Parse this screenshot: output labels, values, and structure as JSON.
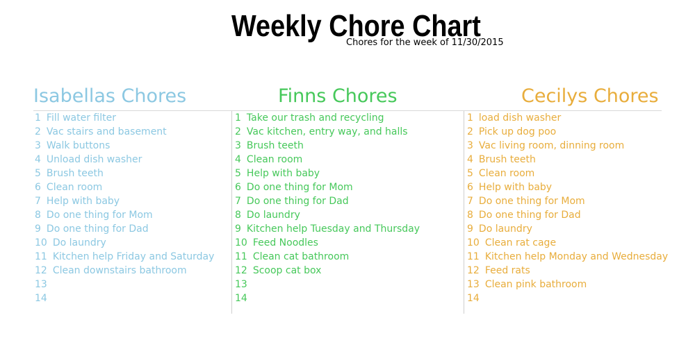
{
  "title": "Weekly Chore Chart",
  "subtitle": "Chores for the week of 11/30/2015",
  "colors": {
    "isabella": "#8cc8e2",
    "finn": "#46c85a",
    "cecily": "#e8ad3c"
  },
  "columns": [
    {
      "heading": "Isabellas Chores",
      "items": [
        {
          "num": "1",
          "text": "Fill water filter"
        },
        {
          "num": "2",
          "text": "Vac stairs and basement"
        },
        {
          "num": "3",
          "text": "Walk buttons"
        },
        {
          "num": "4",
          "text": "Unload dish washer"
        },
        {
          "num": "5",
          "text": "Brush teeth"
        },
        {
          "num": "6",
          "text": "Clean room"
        },
        {
          "num": "7",
          "text": "Help with baby"
        },
        {
          "num": "8",
          "text": "Do one thing for Mom"
        },
        {
          "num": "9",
          "text": "Do one thing for Dad"
        },
        {
          "num": "10",
          "text": "Do laundry"
        },
        {
          "num": "11",
          "text": "Kitchen help Friday and Saturday"
        },
        {
          "num": "12",
          "text": "Clean downstairs bathroom"
        },
        {
          "num": "13",
          "text": ""
        },
        {
          "num": "14",
          "text": ""
        }
      ]
    },
    {
      "heading": "Finns Chores",
      "items": [
        {
          "num": "1",
          "text": "Take our trash and recycling"
        },
        {
          "num": "2",
          "text": "Vac kitchen, entry way, and halls"
        },
        {
          "num": "3",
          "text": "Brush teeth"
        },
        {
          "num": "4",
          "text": "Clean room"
        },
        {
          "num": "5",
          "text": "Help with baby"
        },
        {
          "num": "6",
          "text": "Do one thing for Mom"
        },
        {
          "num": "7",
          "text": "Do one thing for Dad"
        },
        {
          "num": "8",
          "text": "Do laundry"
        },
        {
          "num": "9",
          "text": "Kitchen help Tuesday and Thursday"
        },
        {
          "num": "10",
          "text": "Feed Noodles"
        },
        {
          "num": "11",
          "text": "Clean cat bathroom"
        },
        {
          "num": "12",
          "text": "Scoop cat box"
        },
        {
          "num": "13",
          "text": ""
        },
        {
          "num": "14",
          "text": ""
        }
      ]
    },
    {
      "heading": "Cecilys Chores",
      "items": [
        {
          "num": "1",
          "text": "load dish washer"
        },
        {
          "num": "2",
          "text": "Pick up dog poo"
        },
        {
          "num": "3",
          "text": "Vac living room, dinning room"
        },
        {
          "num": "4",
          "text": "Brush teeth"
        },
        {
          "num": "5",
          "text": "Clean room"
        },
        {
          "num": "6",
          "text": "Help with baby"
        },
        {
          "num": "7",
          "text": "Do one thing for Mom"
        },
        {
          "num": "8",
          "text": "Do one thing for Dad"
        },
        {
          "num": "9",
          "text": "Do laundry"
        },
        {
          "num": "10",
          "text": "Clean rat cage"
        },
        {
          "num": "11",
          "text": "Kitchen help Monday and Wednesday"
        },
        {
          "num": "12",
          "text": "Feed rats"
        },
        {
          "num": "13",
          "text": "Clean pink bathroom"
        },
        {
          "num": "14",
          "text": ""
        }
      ]
    }
  ]
}
